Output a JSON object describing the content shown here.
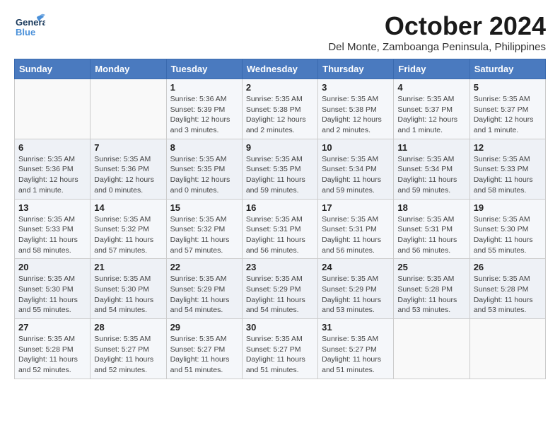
{
  "header": {
    "logo_general": "General",
    "logo_blue": "Blue",
    "month": "October 2024",
    "location": "Del Monte, Zamboanga Peninsula, Philippines"
  },
  "weekdays": [
    "Sunday",
    "Monday",
    "Tuesday",
    "Wednesday",
    "Thursday",
    "Friday",
    "Saturday"
  ],
  "weeks": [
    [
      {
        "day": "",
        "info": ""
      },
      {
        "day": "",
        "info": ""
      },
      {
        "day": "1",
        "info": "Sunrise: 5:36 AM\nSunset: 5:39 PM\nDaylight: 12 hours\nand 3 minutes."
      },
      {
        "day": "2",
        "info": "Sunrise: 5:35 AM\nSunset: 5:38 PM\nDaylight: 12 hours\nand 2 minutes."
      },
      {
        "day": "3",
        "info": "Sunrise: 5:35 AM\nSunset: 5:38 PM\nDaylight: 12 hours\nand 2 minutes."
      },
      {
        "day": "4",
        "info": "Sunrise: 5:35 AM\nSunset: 5:37 PM\nDaylight: 12 hours\nand 1 minute."
      },
      {
        "day": "5",
        "info": "Sunrise: 5:35 AM\nSunset: 5:37 PM\nDaylight: 12 hours\nand 1 minute."
      }
    ],
    [
      {
        "day": "6",
        "info": "Sunrise: 5:35 AM\nSunset: 5:36 PM\nDaylight: 12 hours\nand 1 minute."
      },
      {
        "day": "7",
        "info": "Sunrise: 5:35 AM\nSunset: 5:36 PM\nDaylight: 12 hours\nand 0 minutes."
      },
      {
        "day": "8",
        "info": "Sunrise: 5:35 AM\nSunset: 5:35 PM\nDaylight: 12 hours\nand 0 minutes."
      },
      {
        "day": "9",
        "info": "Sunrise: 5:35 AM\nSunset: 5:35 PM\nDaylight: 11 hours\nand 59 minutes."
      },
      {
        "day": "10",
        "info": "Sunrise: 5:35 AM\nSunset: 5:34 PM\nDaylight: 11 hours\nand 59 minutes."
      },
      {
        "day": "11",
        "info": "Sunrise: 5:35 AM\nSunset: 5:34 PM\nDaylight: 11 hours\nand 59 minutes."
      },
      {
        "day": "12",
        "info": "Sunrise: 5:35 AM\nSunset: 5:33 PM\nDaylight: 11 hours\nand 58 minutes."
      }
    ],
    [
      {
        "day": "13",
        "info": "Sunrise: 5:35 AM\nSunset: 5:33 PM\nDaylight: 11 hours\nand 58 minutes."
      },
      {
        "day": "14",
        "info": "Sunrise: 5:35 AM\nSunset: 5:32 PM\nDaylight: 11 hours\nand 57 minutes."
      },
      {
        "day": "15",
        "info": "Sunrise: 5:35 AM\nSunset: 5:32 PM\nDaylight: 11 hours\nand 57 minutes."
      },
      {
        "day": "16",
        "info": "Sunrise: 5:35 AM\nSunset: 5:31 PM\nDaylight: 11 hours\nand 56 minutes."
      },
      {
        "day": "17",
        "info": "Sunrise: 5:35 AM\nSunset: 5:31 PM\nDaylight: 11 hours\nand 56 minutes."
      },
      {
        "day": "18",
        "info": "Sunrise: 5:35 AM\nSunset: 5:31 PM\nDaylight: 11 hours\nand 56 minutes."
      },
      {
        "day": "19",
        "info": "Sunrise: 5:35 AM\nSunset: 5:30 PM\nDaylight: 11 hours\nand 55 minutes."
      }
    ],
    [
      {
        "day": "20",
        "info": "Sunrise: 5:35 AM\nSunset: 5:30 PM\nDaylight: 11 hours\nand 55 minutes."
      },
      {
        "day": "21",
        "info": "Sunrise: 5:35 AM\nSunset: 5:30 PM\nDaylight: 11 hours\nand 54 minutes."
      },
      {
        "day": "22",
        "info": "Sunrise: 5:35 AM\nSunset: 5:29 PM\nDaylight: 11 hours\nand 54 minutes."
      },
      {
        "day": "23",
        "info": "Sunrise: 5:35 AM\nSunset: 5:29 PM\nDaylight: 11 hours\nand 54 minutes."
      },
      {
        "day": "24",
        "info": "Sunrise: 5:35 AM\nSunset: 5:29 PM\nDaylight: 11 hours\nand 53 minutes."
      },
      {
        "day": "25",
        "info": "Sunrise: 5:35 AM\nSunset: 5:28 PM\nDaylight: 11 hours\nand 53 minutes."
      },
      {
        "day": "26",
        "info": "Sunrise: 5:35 AM\nSunset: 5:28 PM\nDaylight: 11 hours\nand 53 minutes."
      }
    ],
    [
      {
        "day": "27",
        "info": "Sunrise: 5:35 AM\nSunset: 5:28 PM\nDaylight: 11 hours\nand 52 minutes."
      },
      {
        "day": "28",
        "info": "Sunrise: 5:35 AM\nSunset: 5:27 PM\nDaylight: 11 hours\nand 52 minutes."
      },
      {
        "day": "29",
        "info": "Sunrise: 5:35 AM\nSunset: 5:27 PM\nDaylight: 11 hours\nand 51 minutes."
      },
      {
        "day": "30",
        "info": "Sunrise: 5:35 AM\nSunset: 5:27 PM\nDaylight: 11 hours\nand 51 minutes."
      },
      {
        "day": "31",
        "info": "Sunrise: 5:35 AM\nSunset: 5:27 PM\nDaylight: 11 hours\nand 51 minutes."
      },
      {
        "day": "",
        "info": ""
      },
      {
        "day": "",
        "info": ""
      }
    ]
  ]
}
